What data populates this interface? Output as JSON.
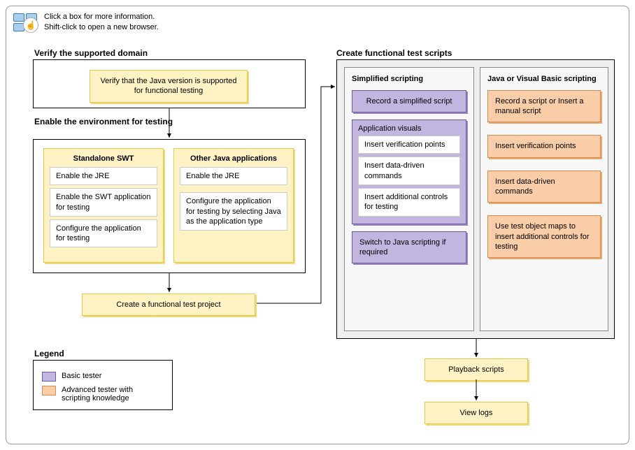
{
  "hints": {
    "line1": "Click a box for more information.",
    "line2": "Shift-click to open a new browser."
  },
  "sec1": {
    "title": "Verify the supported domain",
    "box": "Verify that the Java version is supported for functional testing"
  },
  "sec2": {
    "title": "Enable the environment for testing",
    "col1": {
      "title": "Standalone SWT",
      "items": [
        "Enable the JRE",
        "Enable the SWT application for testing",
        "Configure the application for testing"
      ]
    },
    "col2": {
      "title": "Other Java applications",
      "items": [
        "Enable the JRE",
        "Configure the application for testing by selecting Java as the application type"
      ]
    }
  },
  "createProject": "Create a functional test project",
  "sec3": {
    "title": "Create functional test scripts",
    "left": {
      "title": "Simplified scripting",
      "recordSimple": "Record a simplified script",
      "appVisuals": {
        "title": "Application visuals",
        "items": [
          "Insert verification points",
          "Insert data-driven commands",
          "Insert additional controls for testing"
        ]
      },
      "switchJava": "Switch to Java scripting if required"
    },
    "right": {
      "title": "Java or Visual Basic scripting",
      "items": [
        "Record a script or Insert a manual script",
        "Insert verification points",
        "Insert data-driven commands",
        "Use test object maps to insert additional controls for testing"
      ]
    }
  },
  "playback": "Playback scripts",
  "viewLogs": "View logs",
  "legend": {
    "title": "Legend",
    "basic": "Basic tester",
    "advanced": "Advanced tester with scripting knowledge"
  }
}
